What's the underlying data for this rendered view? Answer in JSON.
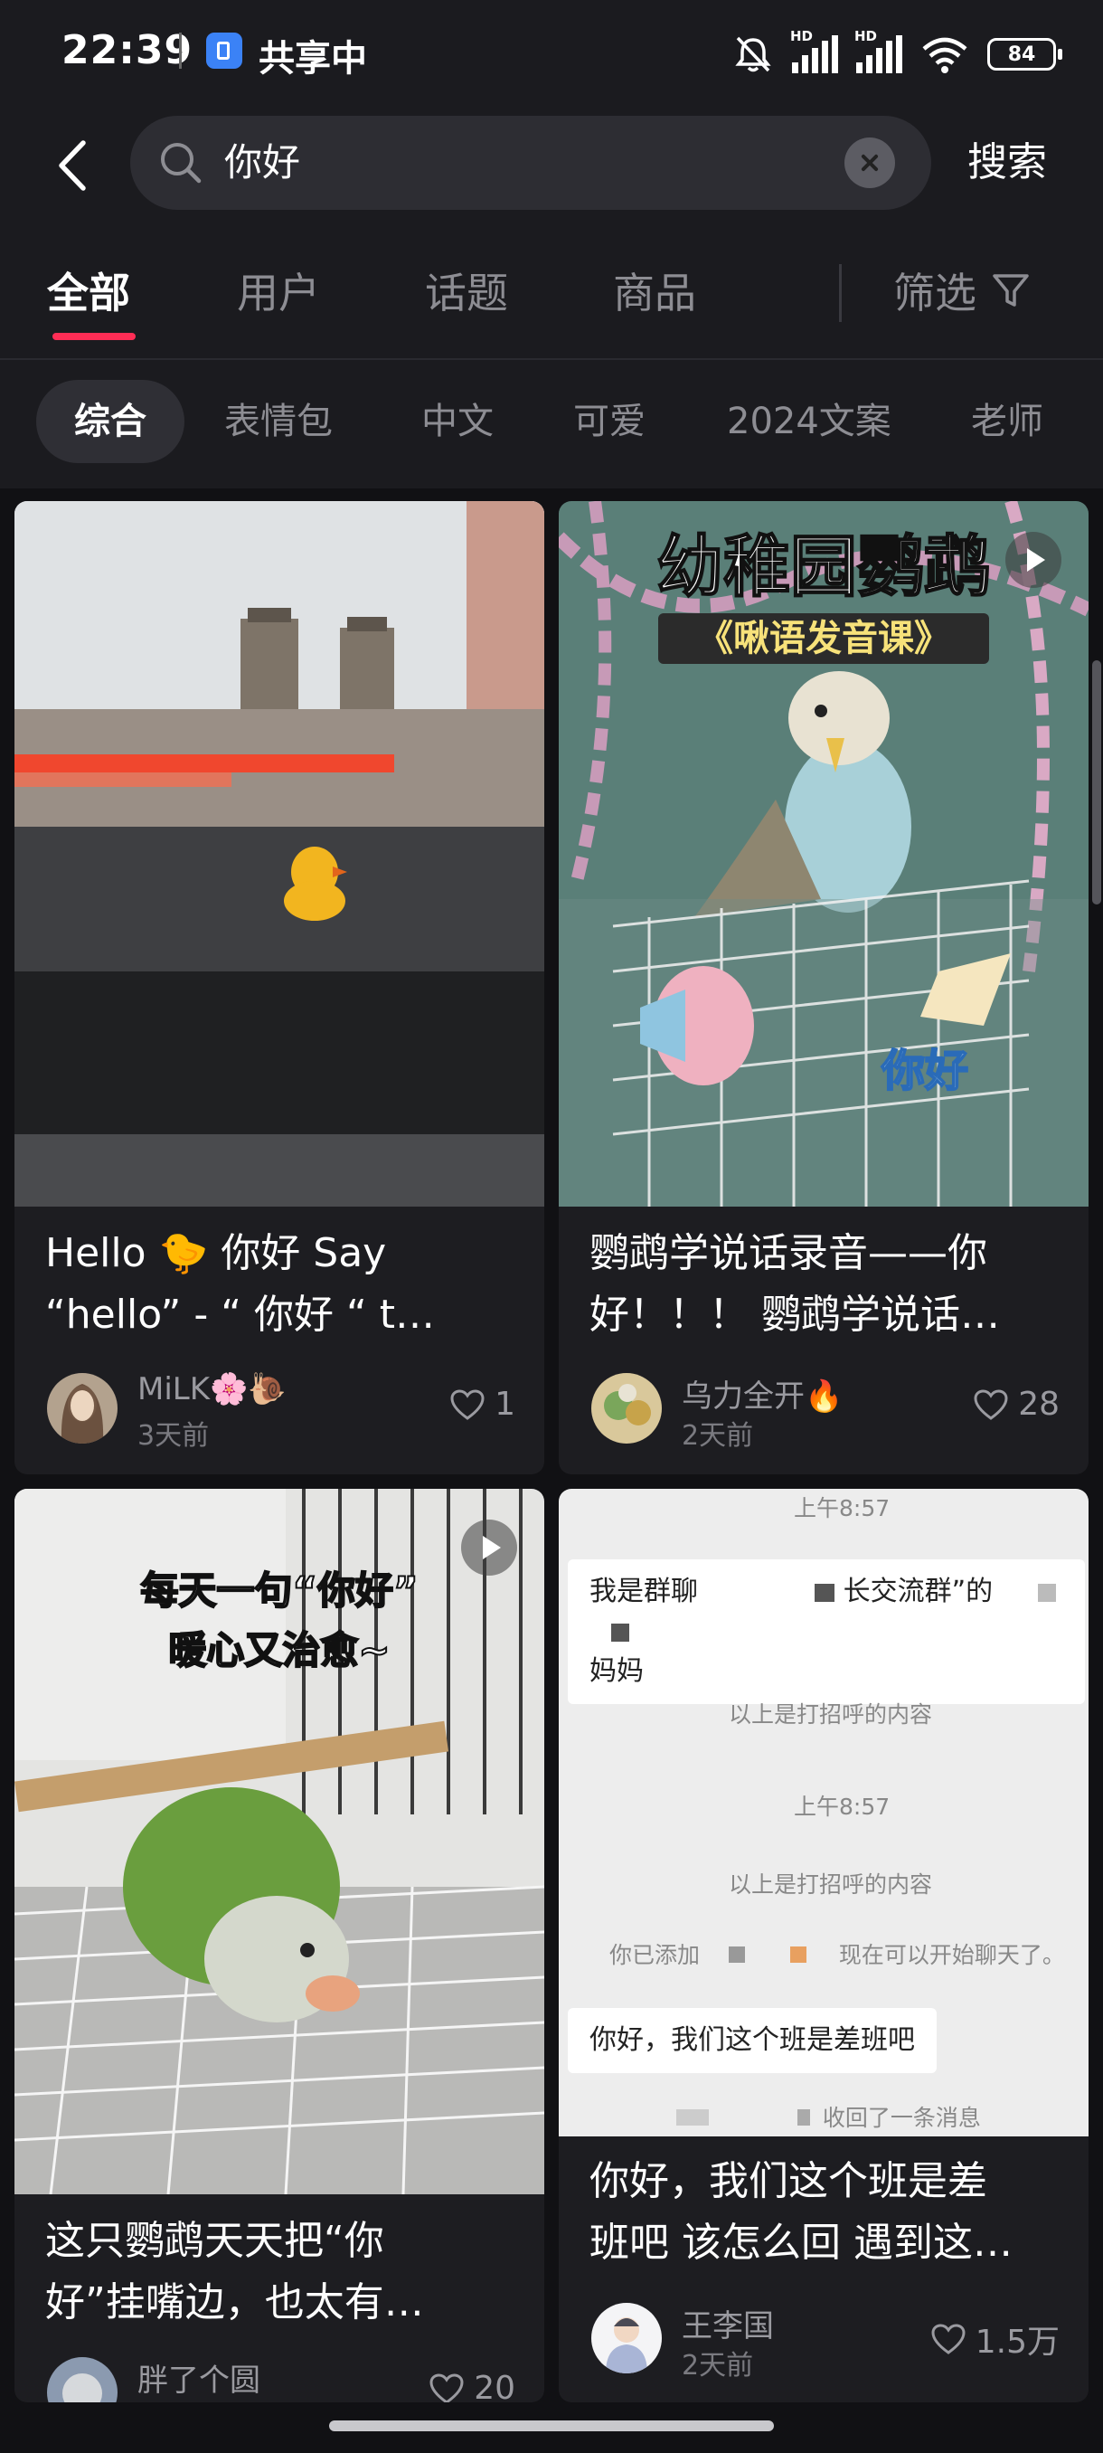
{
  "status_bar": {
    "time": "22:39",
    "sharing_label": "共享中",
    "signal_label": "HD",
    "battery": "84"
  },
  "search": {
    "query": "你好",
    "submit_label": "搜索"
  },
  "tabs": [
    "全部",
    "用户",
    "话题",
    "商品"
  ],
  "filter_label": "筛选",
  "chips": [
    "综合",
    "表情包",
    "中文",
    "可爱",
    "2024文案",
    "老师"
  ],
  "cards": [
    {
      "title_lines": [
        "Hello 🐤 你好 Say",
        "“hello” - “ 你好 “ t…"
      ],
      "author": "MiLK🌸🐌",
      "time": "3天前",
      "likes": "1"
    },
    {
      "overlay_title": "幼稚园鹦鹉",
      "overlay_subtitle": "《啾语发音课》",
      "overlay_sticker": "你好",
      "title_lines": [
        "鹦鹉学说话录音——你",
        "好！！！ 鹦鹉学说话…"
      ],
      "author": "乌力全开🔥",
      "time": "2天前",
      "likes": "28"
    },
    {
      "overlay_lines": [
        "每天一句“你好”",
        "暖心又治愈~"
      ],
      "title_lines": [
        "这只鹦鹉天天把“你",
        "好”挂嘴边，也太有…"
      ],
      "author": "胖了个圆",
      "likes": "20"
    },
    {
      "chat": {
        "time1": "上午8:57",
        "msg1_lines": [
          "我是群聊",
          "长交流群”的",
          "妈妈"
        ],
        "sys1": "以上是打招呼的内容",
        "time2": "上午8:57",
        "sys2": "以上是打招呼的内容",
        "sys3_a": "你已添加",
        "sys3_b": "现在可以开始聊天了。",
        "msg2": "你好，我们这个班是差班吧",
        "sys4": "收回了一条消息"
      },
      "title_lines": [
        "你好，我们这个班是差",
        "班吧 该怎么回 遇到这…"
      ],
      "author": "王李国",
      "time": "2天前",
      "likes": "1.5万"
    }
  ],
  "colors": {
    "background": "#1b1b1f",
    "accent": "#ff2d55",
    "card": "#1d1d21"
  }
}
